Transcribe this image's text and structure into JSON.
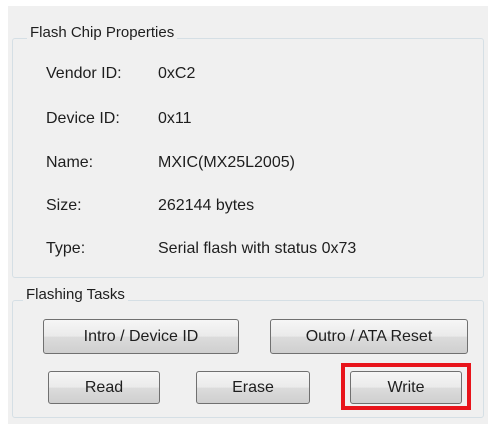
{
  "flash_props": {
    "title": "Flash Chip Properties",
    "vendor_label": "Vendor ID:",
    "vendor_value": "0xC2",
    "device_label": "Device ID:",
    "device_value": "0x11",
    "name_label": "Name:",
    "name_value": "MXIC(MX25L2005)",
    "size_label": "Size:",
    "size_value": "262144 bytes",
    "type_label": "Type:",
    "type_value": "Serial flash with status 0x73"
  },
  "flash_tasks": {
    "title": "Flashing Tasks",
    "intro_label": "Intro / Device ID",
    "outro_label": "Outro / ATA Reset",
    "read_label": "Read",
    "erase_label": "Erase",
    "write_label": "Write"
  },
  "highlight_color": "#e8141b"
}
